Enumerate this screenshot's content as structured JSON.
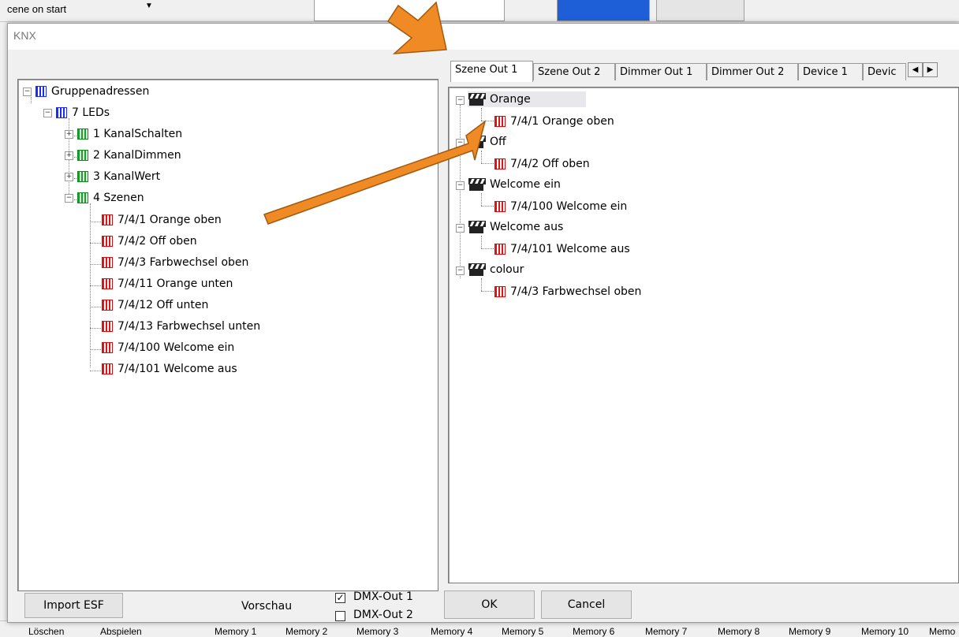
{
  "background": {
    "scene_dropdown_text": "cene on start",
    "bottom_strip": [
      "Löschen",
      "Abspielen",
      "Memory 1",
      "Memory 2",
      "Memory 3",
      "Memory 4",
      "Memory 5",
      "Memory 6",
      "Memory 7",
      "Memory 8",
      "Memory 9",
      "Memory 10",
      "Memo"
    ]
  },
  "dialog": {
    "title": "KNX"
  },
  "left_tree": {
    "root": "Gruppenadressen",
    "group": "7 LEDs",
    "subgroups": [
      "1 KanalSchalten",
      "2 KanalDimmen",
      "3 KanalWert",
      "4 Szenen"
    ],
    "scene_addresses": [
      "7/4/1 Orange oben",
      "7/4/2 Off oben",
      "7/4/3 Farbwechsel oben",
      "7/4/11 Orange unten",
      "7/4/12 Off unten",
      "7/4/13 Farbwechsel unten",
      "7/4/100 Welcome ein",
      "7/4/101 Welcome aus"
    ]
  },
  "tabs": [
    "Szene Out 1",
    "Szene Out 2",
    "Dimmer Out 1",
    "Dimmer Out 2",
    "Device 1",
    "Devic"
  ],
  "right_tree": [
    {
      "scene": "Orange",
      "address": "7/4/1 Orange oben"
    },
    {
      "scene": "Off",
      "address": "7/4/2 Off oben"
    },
    {
      "scene": "Welcome ein",
      "address": "7/4/100 Welcome ein"
    },
    {
      "scene": "Welcome aus",
      "address": "7/4/101 Welcome aus"
    },
    {
      "scene": "colour",
      "address": "7/4/3 Farbwechsel oben"
    }
  ],
  "footer": {
    "import_label": "Import ESF",
    "vorschau_label": "Vorschau",
    "dmx_out_1": "DMX-Out 1",
    "dmx_out_1_checked": true,
    "dmx_out_2": "DMX-Out 2",
    "dmx_out_2_checked": false,
    "ok_label": "OK",
    "cancel_label": "Cancel"
  },
  "colors": {
    "annotation_arrow": "#f08a24",
    "folder_icon": "#1a2bff",
    "subgroup_icon": "#17a02a",
    "address_icon": "#e01515"
  }
}
